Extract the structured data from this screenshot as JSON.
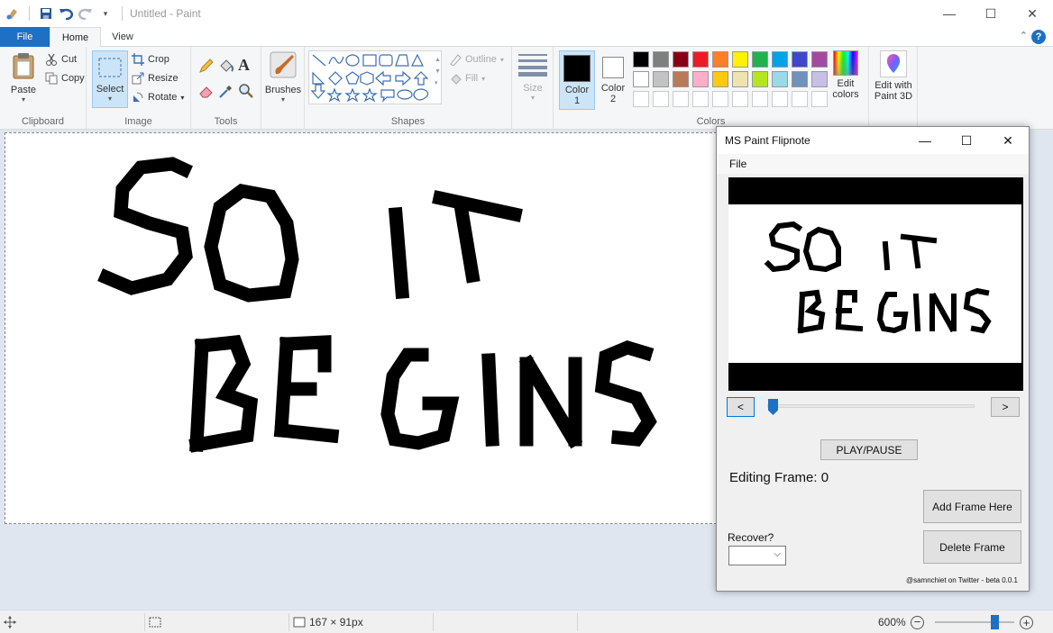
{
  "window": {
    "title": "Untitled - Paint",
    "controls": {
      "minimize": "—",
      "maximize": "☐",
      "close": "✕"
    }
  },
  "quick_access": {
    "icons": [
      "paint-app-icon",
      "save-icon",
      "undo-icon",
      "redo-icon",
      "customize-dropdown-icon"
    ]
  },
  "tabs": [
    {
      "label": "File"
    },
    {
      "label": "Home"
    },
    {
      "label": "View"
    }
  ],
  "help": {
    "label": "?",
    "collapse": "⌃"
  },
  "ribbon": {
    "clipboard": {
      "label": "Clipboard",
      "paste": "Paste",
      "cut": "Cut",
      "copy": "Copy"
    },
    "image": {
      "label": "Image",
      "select": "Select",
      "crop": "Crop",
      "resize": "Resize",
      "rotate": "Rotate"
    },
    "tools": {
      "label": "Tools"
    },
    "brushes": {
      "label": "Brushes"
    },
    "shapes": {
      "label": "Shapes",
      "outline": "Outline",
      "fill": "Fill"
    },
    "size": {
      "label": "Size"
    },
    "colors": {
      "label": "Colors",
      "color1": "Color",
      "color1_num": "1",
      "color2": "Color",
      "color2_num": "2",
      "edit_colors_line1": "Edit",
      "edit_colors_line2": "colors",
      "paint3d_line1": "Edit with",
      "paint3d_line2": "Paint 3D",
      "palette_row1": [
        "#000000",
        "#7f7f7f",
        "#880015",
        "#ed1c24",
        "#ff7f27",
        "#fff200",
        "#22b14c",
        "#00a2e8",
        "#3f48cc",
        "#a349a4"
      ],
      "palette_row2": [
        "#ffffff",
        "#c3c3c3",
        "#b97a57",
        "#ffaec9",
        "#ffc90e",
        "#efe4b0",
        "#b5e61d",
        "#99d9ea",
        "#7092be",
        "#c8bfe7"
      ]
    }
  },
  "canvas": {
    "text_line1": "SO IT",
    "text_line2": "BEGINS"
  },
  "flipnote": {
    "title": "MS Paint Flipnote",
    "menu_file": "File",
    "prev": "<",
    "next": ">",
    "play_pause": "PLAY/PAUSE",
    "editing_frame": "Editing Frame: 0",
    "add_frame": "Add Frame Here",
    "delete_frame": "Delete Frame",
    "recover": "Recover?",
    "credit": "@samnchiet on Twitter - beta 0.0.1",
    "frame_slider_value": 0
  },
  "status": {
    "canvas_size": "167 × 91px",
    "zoom": "600%",
    "zoom_out": "−",
    "zoom_in": "+"
  }
}
